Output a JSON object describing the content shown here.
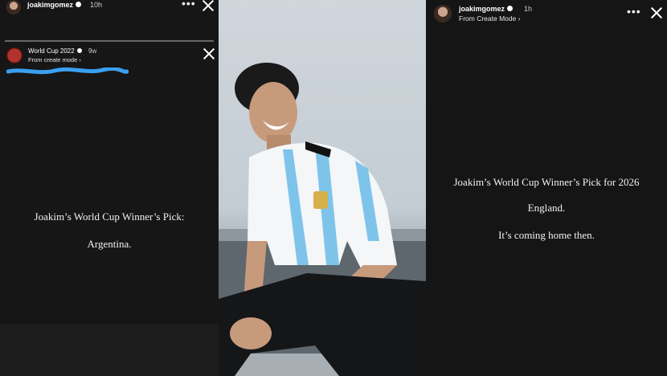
{
  "left": {
    "username": "joakimgomez",
    "time": "10h",
    "inner_account": "World Cup 2022",
    "inner_time": "9w",
    "inner_sub": "From create mode ›",
    "story_line1": "Joakim’s World Cup Winner’s Pick:",
    "story_line2": "Argentina."
  },
  "right": {
    "username": "joakimgomez",
    "time": "1h",
    "sub": "From Create Mode ›",
    "story_line1": "Joakim’s World Cup Winner’s Pick for 2026",
    "story_line2": "England.",
    "story_line3": "It’s coming home then."
  },
  "icons": {
    "more": "more-dots-icon",
    "close": "close-icon",
    "verified": "verified-badge-icon"
  },
  "colors": {
    "scribble": "#3aa0f0",
    "jersey_blue": "#7ec4ea"
  }
}
